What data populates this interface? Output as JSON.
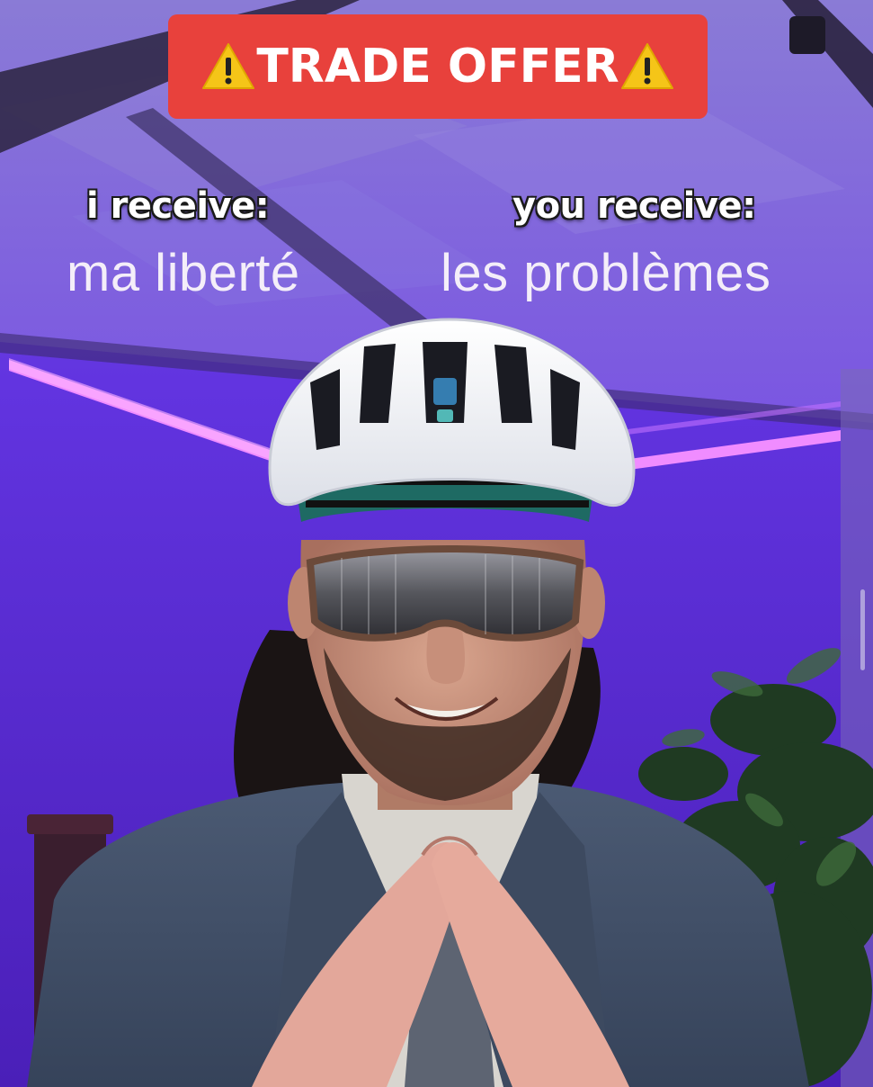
{
  "banner": {
    "title": "TRADE OFFER",
    "left_icon": "warning-icon",
    "right_icon": "warning-icon",
    "color": "#e8413c"
  },
  "captions": {
    "left": "i receive:",
    "right": "you receive:"
  },
  "overlay": {
    "left": "ma liberté",
    "right": "les problèmes"
  },
  "colors": {
    "background": "#5b2fd0",
    "neon": "#e36bff"
  }
}
